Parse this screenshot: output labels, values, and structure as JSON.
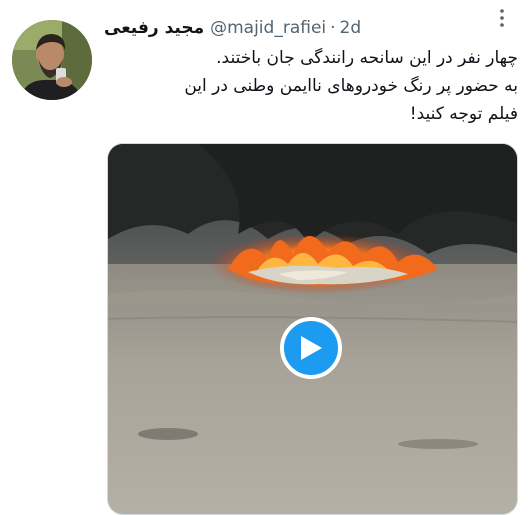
{
  "tweet": {
    "author_name": "مجید رفیعی",
    "handle": "@majid_rafiei",
    "separator": "·",
    "time": "2d",
    "text_lines": [
      "چهار نفر در این سانحه رانندگی جان باختند.",
      "به حضور پر رنگ خودروهای ناایمن وطنی در این",
      "فیلم توجه کنید!"
    ]
  },
  "icons": {
    "avatar": "avatar",
    "caret": "more-options-icon",
    "play": "play-icon"
  },
  "colors": {
    "accent": "#1d9bf0",
    "secondary_text": "#536471",
    "primary_text": "#0f1419",
    "border": "#cfd9de",
    "smoke": "#2d2e2e",
    "fire": "#f26a1b",
    "ground": "#a39f95"
  }
}
